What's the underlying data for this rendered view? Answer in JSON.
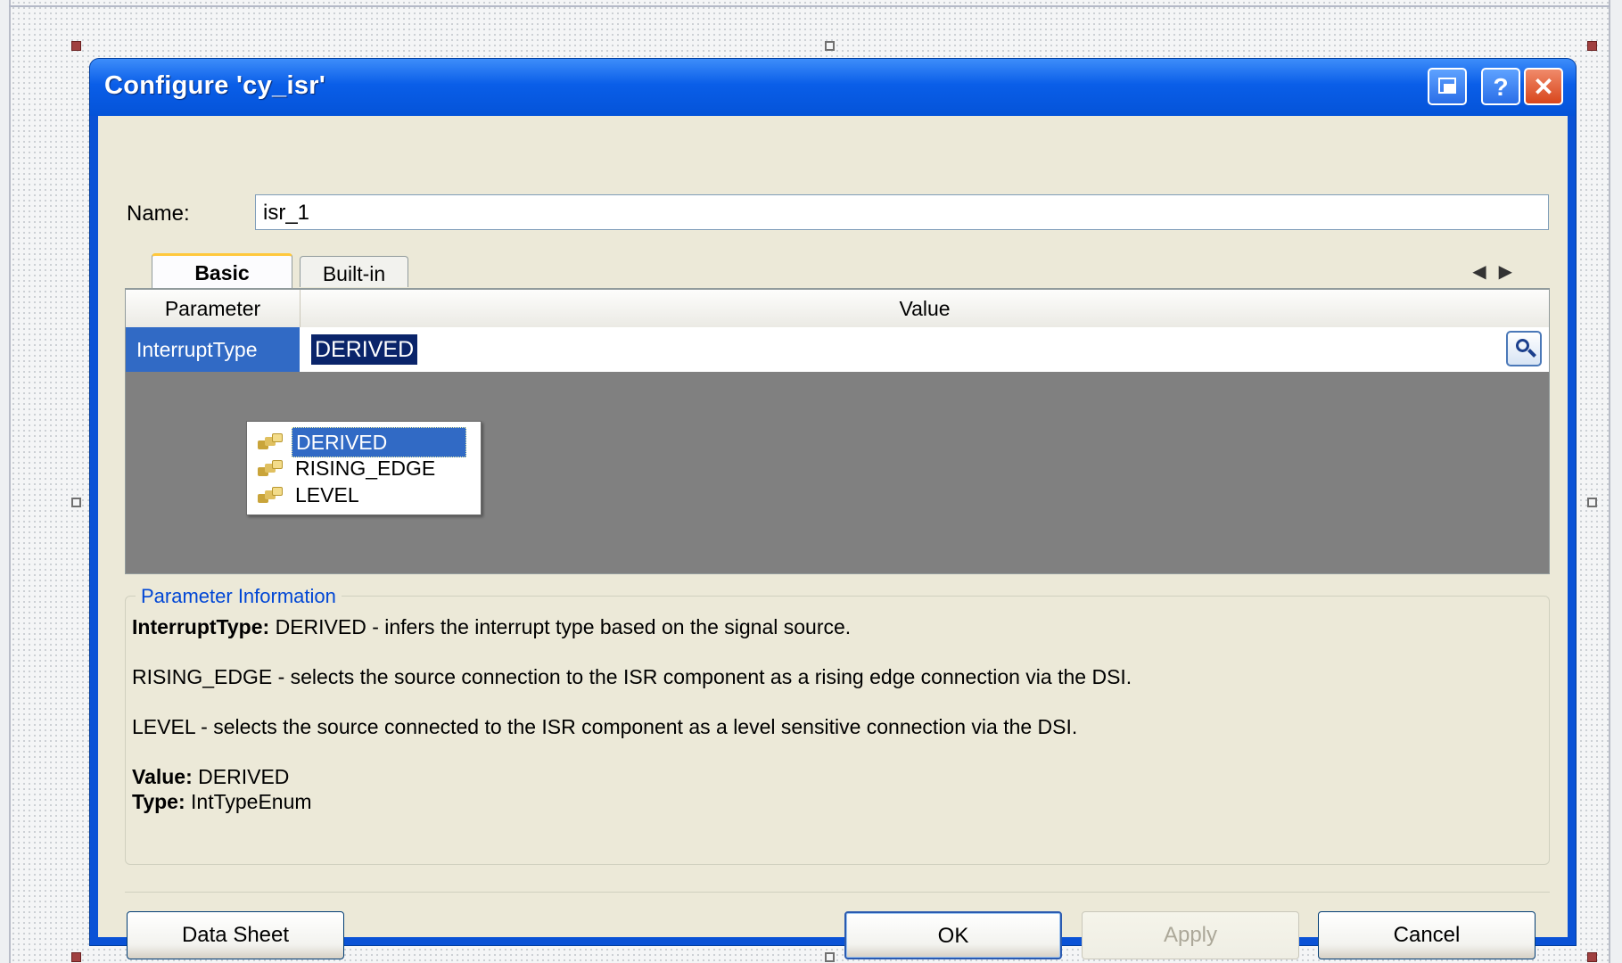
{
  "dialog": {
    "title": "Configure 'cy_isr'",
    "help_glyph": "?",
    "close_glyph": "✕"
  },
  "name_field": {
    "label": "Name:",
    "value": "isr_1"
  },
  "tabs": [
    {
      "label": "Basic",
      "active": true
    },
    {
      "label": "Built-in",
      "active": false
    }
  ],
  "tab_scroll": {
    "left": "◀",
    "right": "▶"
  },
  "grid": {
    "columns": {
      "parameter": "Parameter",
      "value": "Value"
    },
    "rows": [
      {
        "parameter": "InterruptType",
        "value": "DERIVED"
      }
    ]
  },
  "dropdown": {
    "options": [
      "DERIVED",
      "RISING_EDGE",
      "LEVEL"
    ],
    "selected": "DERIVED"
  },
  "info": {
    "legend": "Parameter Information",
    "param_name": "InterruptType:",
    "desc_line1": " DERIVED - infers the interrupt type based on the signal source.",
    "desc_line2": "RISING_EDGE - selects the source connection to the ISR component as a rising edge connection via the DSI.",
    "desc_line3": "LEVEL - selects the source connected to the ISR component as a level sensitive connection via the DSI.",
    "value_label": "Value:",
    "value": " DERIVED",
    "type_label": "Type:",
    "type": " IntTypeEnum"
  },
  "buttons": {
    "datasheet": "Data Sheet",
    "ok": "OK",
    "apply": "Apply",
    "cancel": "Cancel"
  },
  "colors": {
    "title_bar": "#0a5ee8",
    "selection": "#316ac5",
    "grid_empty": "#808080",
    "dialog_body": "#ece9d8",
    "legend_text": "#0046d5"
  }
}
